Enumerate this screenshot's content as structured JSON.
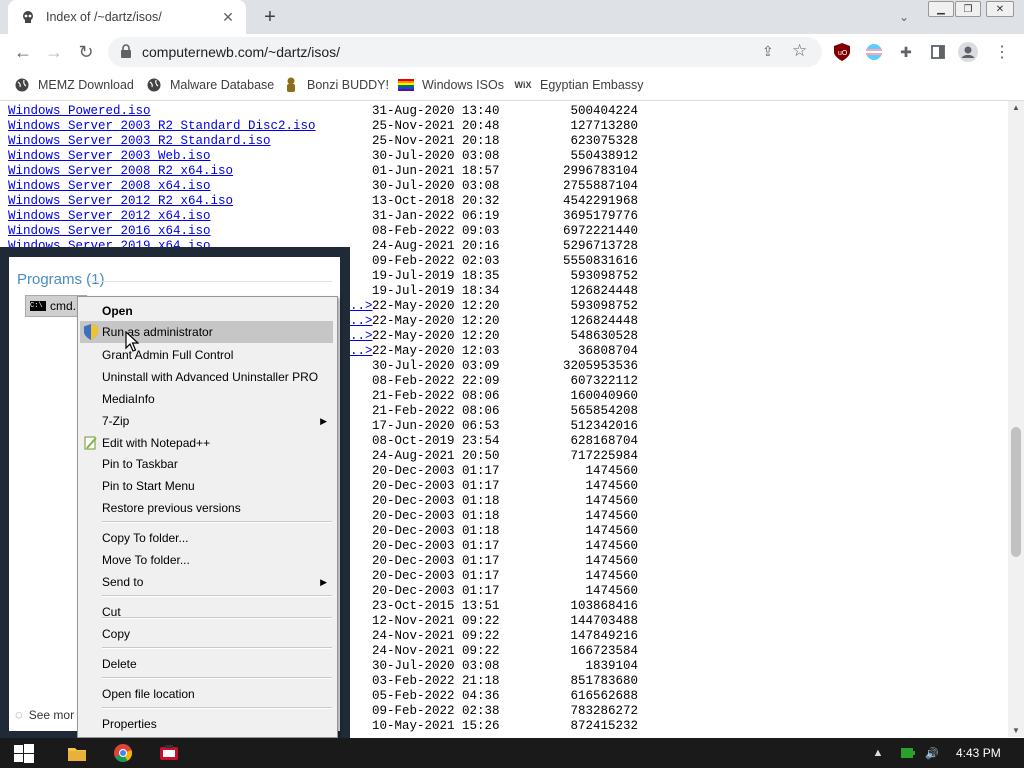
{
  "browser": {
    "tab_title": "Index of /~dartz/isos/",
    "url": "computernewb.com/~dartz/isos/",
    "bookmarks": [
      {
        "label": "MEMZ Download",
        "icon": "globe-icon"
      },
      {
        "label": "Malware Database",
        "icon": "globe-icon"
      },
      {
        "label": "Bonzi BUDDY!",
        "icon": "bonzi-icon"
      },
      {
        "label": "Windows ISOs",
        "icon": "rainbow-flag-icon"
      },
      {
        "label": "Egyptian Embassy",
        "icon": "wix-icon"
      }
    ],
    "accent": "#1a73e8"
  },
  "listing": {
    "rows": [
      {
        "name": "Windows Powered.iso",
        "date": "31-Aug-2020 13:40",
        "size": "500404224"
      },
      {
        "name": "Windows Server 2003 R2 Standard Disc2.iso",
        "date": "25-Nov-2021 20:48",
        "size": "127713280"
      },
      {
        "name": "Windows Server 2003 R2 Standard.iso",
        "date": "25-Nov-2021 20:18",
        "size": "623075328"
      },
      {
        "name": "Windows Server 2003 Web.iso",
        "date": "30-Jul-2020 03:08",
        "size": "550438912"
      },
      {
        "name": "Windows Server 2008 R2 x64.iso",
        "date": "01-Jun-2021 18:57",
        "size": "2996783104"
      },
      {
        "name": "Windows Server 2008 x64.iso",
        "date": "30-Jul-2020 03:08",
        "size": "2755887104"
      },
      {
        "name": "Windows Server 2012 R2 x64.iso",
        "date": "13-Oct-2018 20:32",
        "size": "4542291968"
      },
      {
        "name": "Windows Server 2012 x64.iso",
        "date": "31-Jan-2022 06:19",
        "size": "3695179776"
      },
      {
        "name": "Windows Server 2016 x64.iso",
        "date": "08-Feb-2022 09:03",
        "size": "6972221440"
      },
      {
        "name": "Windows Server 2019 x64.iso",
        "date": "24-Aug-2021 20:16",
        "size": "5296713728"
      },
      {
        "name": "",
        "date": "09-Feb-2022 02:03",
        "size": "5550831616"
      },
      {
        "name": "",
        "date": "19-Jul-2019 18:35",
        "size": "593098752"
      },
      {
        "name": "",
        "date": "19-Jul-2019 18:34",
        "size": "126824448"
      },
      {
        "name": "",
        "date": "22-May-2020 12:20",
        "size": "593098752"
      },
      {
        "name": "",
        "date": "22-May-2020 12:20",
        "size": "126824448"
      },
      {
        "name": "",
        "date": "22-May-2020 12:20",
        "size": "548630528"
      },
      {
        "name": "",
        "date": "22-May-2020 12:03",
        "size": "36808704"
      },
      {
        "name": "",
        "date": "30-Jul-2020 03:09",
        "size": "3205953536"
      },
      {
        "name": "",
        "date": "08-Feb-2022 22:09",
        "size": "607322112"
      },
      {
        "name": "",
        "date": "21-Feb-2022 08:06",
        "size": "160040960"
      },
      {
        "name": "",
        "date": "21-Feb-2022 08:06",
        "size": "565854208"
      },
      {
        "name": "",
        "date": "17-Jun-2020 06:53",
        "size": "512342016"
      },
      {
        "name": "",
        "date": "08-Oct-2019 23:54",
        "size": "628168704"
      },
      {
        "name": "",
        "date": "24-Aug-2021 20:50",
        "size": "717225984"
      },
      {
        "name": "",
        "date": "20-Dec-2003 01:17",
        "size": "1474560"
      },
      {
        "name": "",
        "date": "20-Dec-2003 01:17",
        "size": "1474560"
      },
      {
        "name": "",
        "date": "20-Dec-2003 01:18",
        "size": "1474560"
      },
      {
        "name": "",
        "date": "20-Dec-2003 01:18",
        "size": "1474560"
      },
      {
        "name": "",
        "date": "20-Dec-2003 01:18",
        "size": "1474560"
      },
      {
        "name": "",
        "date": "20-Dec-2003 01:17",
        "size": "1474560"
      },
      {
        "name": "",
        "date": "20-Dec-2003 01:17",
        "size": "1474560"
      },
      {
        "name": "",
        "date": "20-Dec-2003 01:17",
        "size": "1474560"
      },
      {
        "name": "",
        "date": "20-Dec-2003 01:17",
        "size": "1474560"
      },
      {
        "name": "",
        "date": "23-Oct-2015 13:51",
        "size": "103868416"
      },
      {
        "name": "",
        "date": "12-Nov-2021 09:22",
        "size": "144703488"
      },
      {
        "name": "",
        "date": "24-Nov-2021 09:22",
        "size": "147849216"
      },
      {
        "name": "",
        "date": "24-Nov-2021 09:22",
        "size": "166723584"
      },
      {
        "name": "",
        "date": "30-Jul-2020 03:08",
        "size": "1839104"
      },
      {
        "name": "",
        "date": "03-Feb-2022 21:18",
        "size": "851783680"
      },
      {
        "name": "",
        "date": "05-Feb-2022 04:36",
        "size": "616562688"
      },
      {
        "name": "",
        "date": "09-Feb-2022 02:38",
        "size": "783286272"
      },
      {
        "name": "",
        "date": "10-May-2021 15:26",
        "size": "872415232"
      }
    ],
    "truncated_link_marker": "..>"
  },
  "start_menu": {
    "programs_heading": "Programs (1)",
    "cmd_label": "cmd.",
    "see_more": "See mor"
  },
  "context_menu": {
    "items": [
      {
        "label": "Open",
        "bold": true
      },
      {
        "label": "Run as administrator",
        "icon": "shield-icon",
        "highlighted": true
      },
      {
        "label": "Grant Admin Full Control"
      },
      {
        "label": "Uninstall with Advanced Uninstaller PRO"
      },
      {
        "label": "MediaInfo"
      },
      {
        "label": "7-Zip",
        "submenu": true
      },
      {
        "label": "Edit with Notepad++",
        "icon": "notepadpp-icon"
      },
      {
        "label": "Pin to Taskbar"
      },
      {
        "label": "Pin to Start Menu"
      },
      {
        "label": "Restore previous versions"
      },
      {
        "label": "Copy To folder..."
      },
      {
        "label": "Move To folder..."
      },
      {
        "label": "Send to",
        "submenu": true
      },
      {
        "label": "Cut"
      },
      {
        "label": "Copy"
      },
      {
        "label": "Delete"
      },
      {
        "label": "Open file location"
      },
      {
        "label": "Properties"
      }
    ]
  },
  "taskbar": {
    "clock": "4:43 PM",
    "apps": [
      "explorer-icon",
      "chrome-icon",
      "media-app-icon"
    ]
  }
}
